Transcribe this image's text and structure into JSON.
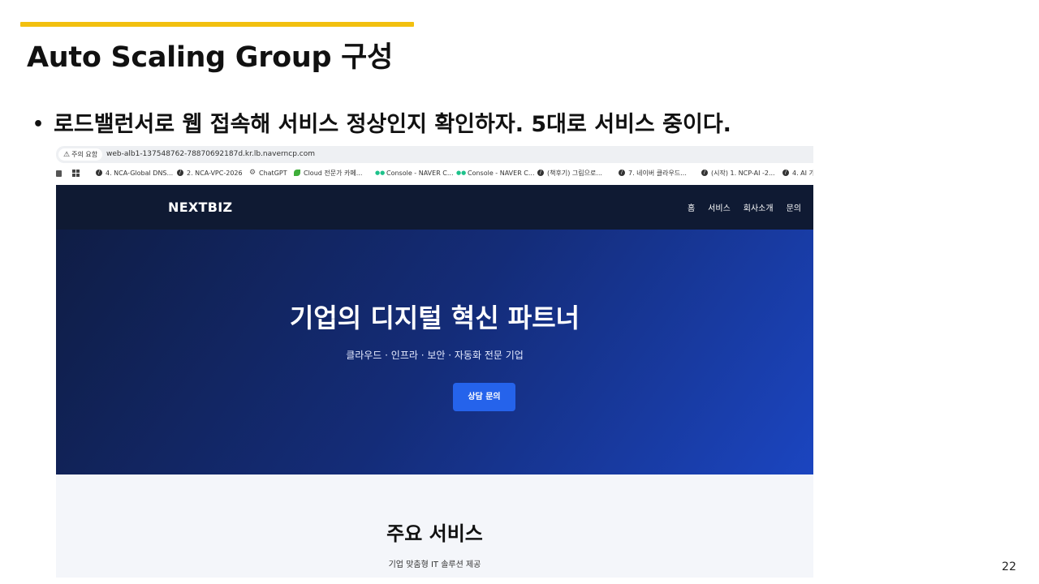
{
  "slide": {
    "title": "Auto Scaling Group 구성",
    "bullet": "로드밸런서로 웹 접속해 서비스 정상인지 확인하자.  5대로 서비스 중이다.",
    "page_number": "22",
    "accent_color": "#f2c00f"
  },
  "browser": {
    "security_chip": "주의 요함",
    "url": "web-alb1-137548762-78870692187d.kr.lb.naverncp.com",
    "bookmarks": [
      {
        "icon": "link-icon",
        "label": "4. NCA-Global DNS..."
      },
      {
        "icon": "link-icon",
        "label": "2. NCA-VPC-2026"
      },
      {
        "icon": "chatgpt-icon",
        "label": "ChatGPT"
      },
      {
        "icon": "leaf-icon",
        "label": "Cloud 전문가 카페..."
      },
      {
        "icon": "ncp-icon",
        "label": "Console - NAVER C..."
      },
      {
        "icon": "ncp-icon",
        "label": "Console - NAVER C..."
      },
      {
        "icon": "link-icon",
        "label": "(책후기) 그림으로..."
      },
      {
        "icon": "link-icon",
        "label": "7. 네이버 클라우드..."
      },
      {
        "icon": "link-icon",
        "label": "(시작) 1. NCP-AI -2..."
      },
      {
        "icon": "link-icon",
        "label": "4. AI 가"
      }
    ]
  },
  "site": {
    "logo": "NEXTBIZ",
    "nav": [
      "홈",
      "서비스",
      "회사소개",
      "문의"
    ],
    "hero": {
      "title": "기업의 디지털 혁신 파트너",
      "subtitle": "클라우드 · 인프라 · 보안 · 자동화 전문 기업",
      "cta": "상담 문의"
    },
    "services": {
      "title": "주요 서비스",
      "subtitle": "기업 맞춤형 IT 솔루션 제공"
    },
    "colors": {
      "header": "#0f1a33",
      "hero_start": "#0f1d45",
      "hero_end": "#1b45c0",
      "cta": "#2563eb"
    }
  }
}
